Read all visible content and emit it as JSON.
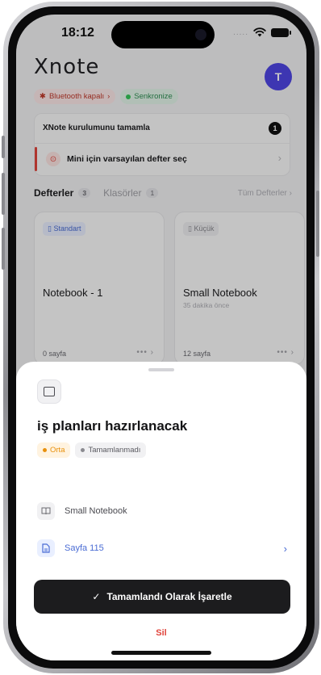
{
  "status_bar": {
    "time": "18:12",
    "signal": "....."
  },
  "header": {
    "logo": "Xnote",
    "avatar_initial": "T",
    "bluetooth_chip": "Bluetooth kapalı",
    "sync_chip": "Senkronize"
  },
  "setup": {
    "title": "XNote kurulumunu tamamla",
    "count": "1",
    "item_label": "Mini için varsayılan defter seç"
  },
  "tabs": {
    "notebooks_label": "Defterler",
    "notebooks_count": "3",
    "folders_label": "Klasörler",
    "folders_count": "1",
    "all_link": "Tüm Defterler"
  },
  "notebooks": [
    {
      "type": "Standart",
      "name": "Notebook - 1",
      "subtitle": "",
      "pages": "0 sayfa",
      "more": "•••"
    },
    {
      "type": "Küçük",
      "name": "Small Notebook",
      "subtitle": "35 dakika önce",
      "pages": "12 sayfa",
      "more": "•••"
    }
  ],
  "sheet": {
    "task_title": "iş planları hazırlanacak",
    "priority": "Orta",
    "status": "Tamamlanmadı",
    "notebook_name": "Small Notebook",
    "page_ref": "Sayfa 115",
    "primary_button": "Tamamlandı Olarak İşaretle",
    "delete_button": "Sil"
  },
  "colors": {
    "accent": "#4f46e5",
    "danger": "#e0443c",
    "priority": "#e8900c",
    "sync": "#34c759"
  }
}
